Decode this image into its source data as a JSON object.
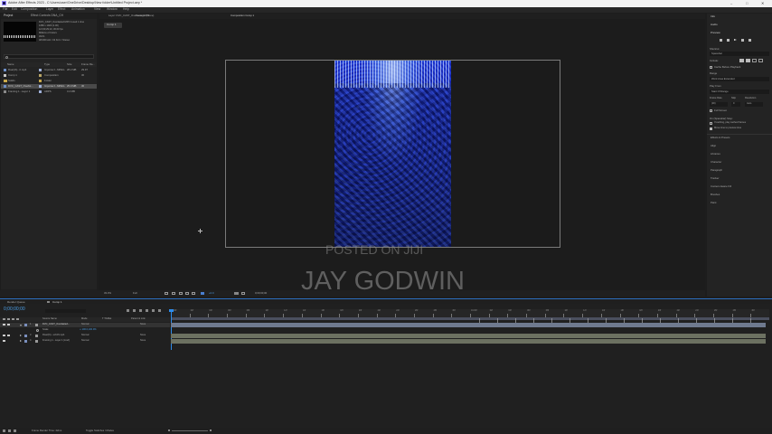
{
  "window": {
    "title": "Adobe After Effects 2023 - C:\\Users\\user\\OneDrive\\Desktop\\New folder\\Untitled Project.aep *",
    "controls": [
      "–",
      "□",
      "✕"
    ]
  },
  "menubar": [
    "File",
    "Edit",
    "Composition",
    "Layer",
    "Effect",
    "Animation",
    "View",
    "Window",
    "Help"
  ],
  "project_panel": {
    "tab": "Project",
    "tab2": "Effect Controls DNA_CH",
    "info_lines": [
      "DVC_CAST_Overlasted.MP4  ▾  used 1 time",
      "1080 x 1920 (1.00)",
      "Δ 0;00;29;10, 30.00 fps",
      "Millions of Colors",
      "AVC1",
      "48.000 kHz / 32 bit U / Stereo"
    ],
    "search_placeholder": "",
    "columns": [
      "Name",
      "Type",
      "Size",
      "Frame Ra..."
    ],
    "items": [
      {
        "name": "Roar(th)...h.mp4",
        "type": "ImporterJ...MPEG",
        "size": "28.2 MB",
        "fps": "29.97"
      },
      {
        "name": "Comp 1",
        "type": "Composition",
        "size": "",
        "fps": "30"
      },
      {
        "name": "Solids",
        "type": "Folder",
        "size": "",
        "fps": ""
      },
      {
        "name": "DVC_CAST_Overlst...",
        "type": "ImporterJ...MPEG",
        "size": "25.0 MB",
        "fps": "30"
      },
      {
        "name": "Framing 1...Layer 1",
        "type": "ARPS",
        "size": "3.2 MB",
        "fps": ""
      }
    ],
    "footer_bpc": "8 bpc"
  },
  "viewer": {
    "tab_layer": "Layer: DVC_CAST_Overlasted.MP4",
    "tab_footage": "Footage: (None)",
    "tab_comp": "Composition  Comp 1",
    "breadcrumb": "Comp 1",
    "zoom": "33.3%",
    "resolution": "Full",
    "exposure": "+0.0",
    "timecode": "0;00;00;00"
  },
  "right_panel": {
    "items": [
      "Info",
      "Audio",
      "Preview"
    ],
    "shortcut_label": "Shortcut",
    "shortcut_value": "Spacebar",
    "include_label": "Include:",
    "cache_label": "Cache Before Playback",
    "range_label": "Range",
    "range_value": "Work Area Extended",
    "play_from_label": "Play From",
    "play_from_value": "Start Of Range",
    "frame_rate_label": "Frame Rate",
    "skip_label": "Skip",
    "resolution_label": "Resolution",
    "frame_rate_value": "(30)",
    "skip_value": "0",
    "resolution_value": "Auto",
    "full_screen": "Full Screen",
    "on_stop_label": "On (Spacebar) Stop:",
    "if_caching": "If caching, play cached frames",
    "move_time": "Move time to preview time",
    "panels": [
      "Effects & Presets",
      "Align",
      "Libraries",
      "Character",
      "Paragraph",
      "Tracker",
      "Content-Aware Fill",
      "Brushes",
      "Paint"
    ]
  },
  "timeline": {
    "tab_render": "Render Queue",
    "tab_comp": "Comp 1",
    "timecode": "0;00;00;00",
    "columns": [
      "Source Name",
      "Mode",
      "T TrkMat",
      "Parent & Link"
    ],
    "layers": [
      {
        "num": "1",
        "name": "DVC_CAST_Overlasted...",
        "mode": "Normal",
        "parent": "None"
      },
      {
        "num": "2",
        "name": "Scale",
        "mode": "",
        "parent": ""
      },
      {
        "num": "3",
        "name": "Roar(th)...schrift.mp4",
        "mode": "Normal",
        "parent": "None"
      },
      {
        "num": "4",
        "name": "Framing 1...Layer 1 [mod]",
        "mode": "Normal",
        "parent": "None"
      }
    ],
    "scale_value": "∞ 100.0,100.0%",
    "ruler_marks": [
      "0;00f",
      "02f",
      "04f",
      "06f",
      "08f",
      "10f",
      "12f",
      "14f",
      "16f",
      "18f",
      "20f",
      "22f",
      "24f",
      "26f",
      "28f",
      "30f",
      "01:00f",
      "02f",
      "04f",
      "06f",
      "08f",
      "10f",
      "12f",
      "14f",
      "16f",
      "18f",
      "20f",
      "22f",
      "24f",
      "26f",
      "28f",
      "30f"
    ],
    "footer_render_time": "Frame Render Time: 42ms",
    "footer_toggle": "Toggle Switches / Modes"
  },
  "watermark": {
    "line1": "POSTED ON JIJI",
    "line2": "JAY GODWIN"
  },
  "colors": {
    "bg": "#1d1d1d",
    "panel": "#232323",
    "accent": "#2d8ceb",
    "label_blue": "#7a8fbe",
    "clip_top": "#6f7a8f",
    "clip": "#6c7161"
  }
}
